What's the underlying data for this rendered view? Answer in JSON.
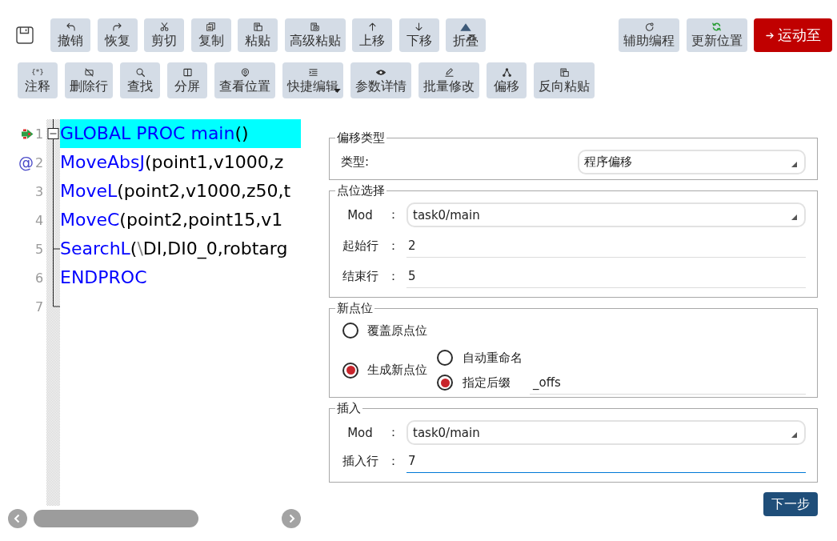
{
  "toolbar": {
    "row_1": [
      {
        "kind": "undo",
        "label": "撤销"
      },
      {
        "kind": "redo",
        "label": "恢复"
      },
      {
        "kind": "cut",
        "label": "剪切"
      },
      {
        "kind": "copy",
        "label": "复制"
      },
      {
        "kind": "paste",
        "label": "粘贴"
      },
      {
        "kind": "paste-special",
        "label": "高级粘贴"
      },
      {
        "kind": "move-up",
        "label": "上移"
      },
      {
        "kind": "move-down",
        "label": "下移"
      },
      {
        "kind": "fold",
        "label": "折叠"
      }
    ],
    "row_1_right": [
      {
        "kind": "assist",
        "label": "辅助编程",
        "primary": false
      },
      {
        "kind": "refresh",
        "label": "更新位置",
        "primary": false
      },
      {
        "kind": "move-to",
        "label": "运动至",
        "primary": true
      }
    ],
    "row_2": [
      {
        "kind": "comment",
        "glyph": "{*}",
        "label": "注释",
        "dropdown": false
      },
      {
        "kind": "delete-line",
        "label": "删除行",
        "dropdown": false
      },
      {
        "kind": "search",
        "label": "查找",
        "dropdown": false
      },
      {
        "kind": "split",
        "label": "分屏",
        "dropdown": false
      },
      {
        "kind": "view-position",
        "label": "查看位置",
        "dropdown": false
      },
      {
        "kind": "quick-edit",
        "label": "快捷编辑",
        "dropdown": true
      },
      {
        "kind": "details",
        "label": "参数详情",
        "dropdown": false
      },
      {
        "kind": "batch-edit",
        "label": "批量修改",
        "dropdown": false
      },
      {
        "kind": "offset",
        "label": "偏移",
        "dropdown": false
      },
      {
        "kind": "reverse-paste",
        "label": "反向粘贴",
        "dropdown": false
      }
    ]
  },
  "editor": {
    "lines": [
      {
        "number": "1",
        "marker": {
          "kind": "pointer"
        },
        "fold": {
          "kind": "start",
          "expanded": true
        },
        "highlighted": true,
        "tokens": [
          {
            "kind": "keyword",
            "text": "GLOBAL PROC main"
          },
          {
            "kind": "plain",
            "text": "()"
          }
        ]
      },
      {
        "number": "2",
        "marker": {
          "kind": "text",
          "text": "@"
        },
        "highlighted": false,
        "tokens": [
          {
            "kind": "keyword",
            "text": "MoveAbsJ"
          },
          {
            "kind": "plain",
            "text": "(point1,v1000,z"
          }
        ]
      },
      {
        "number": "3",
        "highlighted": false,
        "tokens": [
          {
            "kind": "keyword",
            "text": "MoveL"
          },
          {
            "kind": "plain",
            "text": "(point2,v1000,z50,t"
          }
        ]
      },
      {
        "number": "4",
        "highlighted": false,
        "tokens": [
          {
            "kind": "keyword",
            "text": "MoveC"
          },
          {
            "kind": "plain",
            "text": "(point2,point15,v1"
          }
        ]
      },
      {
        "number": "5",
        "fold": {
          "kind": "tick"
        },
        "highlighted": false,
        "tokens": [
          {
            "kind": "keyword",
            "text": "SearchL"
          },
          {
            "kind": "plain",
            "text": "("
          },
          {
            "kind": "escape",
            "text": "\\"
          },
          {
            "kind": "plain",
            "text": "DI,DI0_0,robtarg"
          }
        ]
      },
      {
        "number": "6",
        "highlighted": false,
        "tokens": [
          {
            "kind": "keyword",
            "text": "ENDPROC"
          }
        ]
      },
      {
        "number": "7",
        "fold": {
          "kind": "end"
        },
        "highlighted": false
      }
    ]
  },
  "offset_form": {
    "offset_type": {
      "legend": "偏移类型",
      "label": "类型:",
      "value": "程序偏移"
    },
    "point_selection": {
      "legend": "点位选择",
      "fields": [
        {
          "kind": "select",
          "label": "Mod",
          "separator": "：",
          "value": "task0/main",
          "focused": false
        },
        {
          "kind": "input",
          "label": "起始行",
          "separator": "：",
          "value": "2",
          "focused": false
        },
        {
          "kind": "input",
          "label": "结束行",
          "separator": "：",
          "value": "5",
          "focused": false
        }
      ]
    },
    "new_point": {
      "legend": "新点位",
      "options": [
        {
          "label": "覆盖原点位",
          "selected": false
        },
        {
          "label": "生成新点位",
          "selected": true,
          "sub_options": [
            {
              "label": "自动重命名",
              "selected": false
            },
            {
              "label": "指定后缀",
              "selected": true,
              "value": "_offs"
            }
          ]
        }
      ]
    },
    "insert": {
      "legend": "插入",
      "fields": [
        {
          "kind": "select",
          "label": "Mod",
          "separator": "：",
          "value": "task0/main",
          "focused": false
        },
        {
          "kind": "input",
          "label": "插入行",
          "separator": "：",
          "value": "7",
          "focused": true
        }
      ]
    }
  },
  "next_button": {
    "label": "下一步"
  }
}
